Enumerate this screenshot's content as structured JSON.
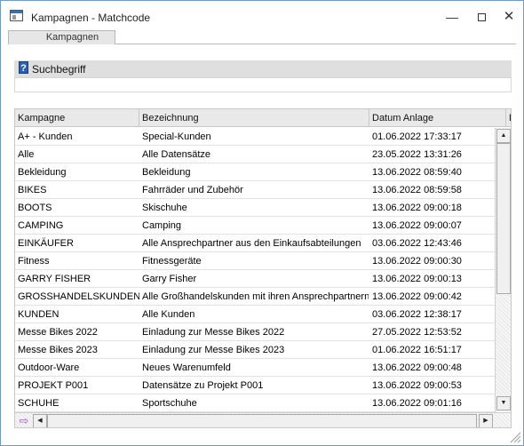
{
  "window": {
    "title": "Kampagnen - Matchcode",
    "minimize_glyph": "—",
    "close_glyph": "✕"
  },
  "tabs": [
    {
      "label": "Kampagnen"
    }
  ],
  "search": {
    "label": "Suchbegriff",
    "help_glyph": "?",
    "value": "",
    "placeholder": ""
  },
  "grid": {
    "columns": [
      "Kampagne",
      "Bezeichnung",
      "Datum Anlage",
      "D"
    ],
    "rows": [
      {
        "kampagne": "A+ - Kunden",
        "bezeichnung": "Special-Kunden",
        "datum": "01.06.2022 17:33:17"
      },
      {
        "kampagne": "Alle",
        "bezeichnung": "Alle Datensätze",
        "datum": "23.05.2022 13:31:26"
      },
      {
        "kampagne": "Bekleidung",
        "bezeichnung": "Bekleidung",
        "datum": "13.06.2022 08:59:40"
      },
      {
        "kampagne": "BIKES",
        "bezeichnung": "Fahrräder und Zubehör",
        "datum": "13.06.2022 08:59:58"
      },
      {
        "kampagne": "BOOTS",
        "bezeichnung": "Skischuhe",
        "datum": "13.06.2022 09:00:18"
      },
      {
        "kampagne": "CAMPING",
        "bezeichnung": "Camping",
        "datum": "13.06.2022 09:00:07"
      },
      {
        "kampagne": "EINKÄUFER",
        "bezeichnung": "Alle Ansprechpartner aus den Einkaufsabteilungen",
        "datum": "03.06.2022 12:43:46"
      },
      {
        "kampagne": "Fitness",
        "bezeichnung": "Fitnessgeräte",
        "datum": "13.06.2022 09:00:30"
      },
      {
        "kampagne": "GARRY FISHER",
        "bezeichnung": "Garry Fisher",
        "datum": "13.06.2022 09:00:13"
      },
      {
        "kampagne": "GROSSHANDELSKUNDEN",
        "bezeichnung": "Alle Großhandelskunden mit ihren Ansprechpartnern",
        "datum": "13.06.2022 09:00:42"
      },
      {
        "kampagne": "KUNDEN",
        "bezeichnung": "Alle Kunden",
        "datum": "03.06.2022 12:38:17"
      },
      {
        "kampagne": "Messe Bikes 2022",
        "bezeichnung": "Einladung zur Messe Bikes 2022",
        "datum": "27.05.2022 12:53:52"
      },
      {
        "kampagne": "Messe Bikes 2023",
        "bezeichnung": "Einladung zur Messe Bikes 2023",
        "datum": "01.06.2022 16:51:17"
      },
      {
        "kampagne": "Outdoor-Ware",
        "bezeichnung": "Neues Warenumfeld",
        "datum": "13.06.2022 09:00:48"
      },
      {
        "kampagne": "PROJEKT P001",
        "bezeichnung": "Datensätze zu Projekt P001",
        "datum": "13.06.2022 09:00:53"
      },
      {
        "kampagne": "SCHUHE",
        "bezeichnung": "Sportschuhe",
        "datum": "13.06.2022 09:01:16"
      }
    ]
  },
  "scrollbars": {
    "up_glyph": "▲",
    "down_glyph": "▼",
    "left_glyph": "◀",
    "right_glyph": "▶",
    "nav_glyph": "⇨"
  }
}
